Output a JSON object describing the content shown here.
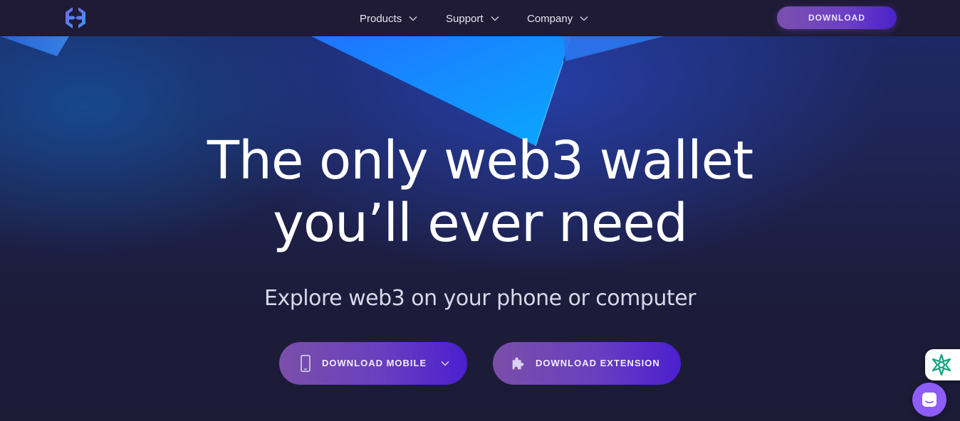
{
  "brand": {
    "logo_icon": "exodus-logo-icon"
  },
  "nav": {
    "items": [
      {
        "label": "Products"
      },
      {
        "label": "Support"
      },
      {
        "label": "Company"
      }
    ],
    "download_label": "DOWNLOAD"
  },
  "hero": {
    "headline_line1": "The only web3 wallet",
    "headline_line2": "you’ll ever need",
    "subheadline": "Explore web3 on your phone or computer",
    "cta_mobile_label": "DOWNLOAD MOBILE",
    "cta_extension_label": "DOWNLOAD EXTENSION"
  },
  "widgets": {
    "assistant_icon": "ai-star-icon",
    "chat_icon": "chat-icon"
  },
  "colors": {
    "navbar_bg": "#1f1a35",
    "button_gradient_start": "#7a4fa9",
    "button_gradient_end": "#4b1fcf",
    "chat_bubble": "#8e5cf7",
    "assistant_green": "#10a37f"
  }
}
